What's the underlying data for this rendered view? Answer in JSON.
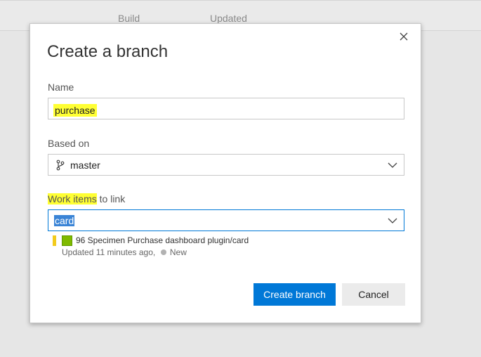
{
  "background": {
    "columns": [
      "Build",
      "Updated"
    ]
  },
  "dialog": {
    "title": "Create a branch",
    "name": {
      "label": "Name",
      "value": "purchase"
    },
    "based_on": {
      "label": "Based on",
      "value": "master",
      "icon": "branch-icon"
    },
    "work_items": {
      "label_highlighted": "Work items",
      "label_rest": " to link",
      "input_value": "card",
      "results": [
        {
          "id_title": "96 Specimen Purchase dashboard plugin/card",
          "updated": "Updated 11 minutes ago,",
          "state": "New",
          "state_color": "#b2b2b2",
          "bar_color": "#f2cb1d",
          "type_color": "#7fba00"
        }
      ]
    },
    "buttons": {
      "create": "Create branch",
      "cancel": "Cancel"
    },
    "colors": {
      "primary": "#0078d7",
      "highlight": "#ffff33",
      "selection": "#3a84d6"
    }
  }
}
